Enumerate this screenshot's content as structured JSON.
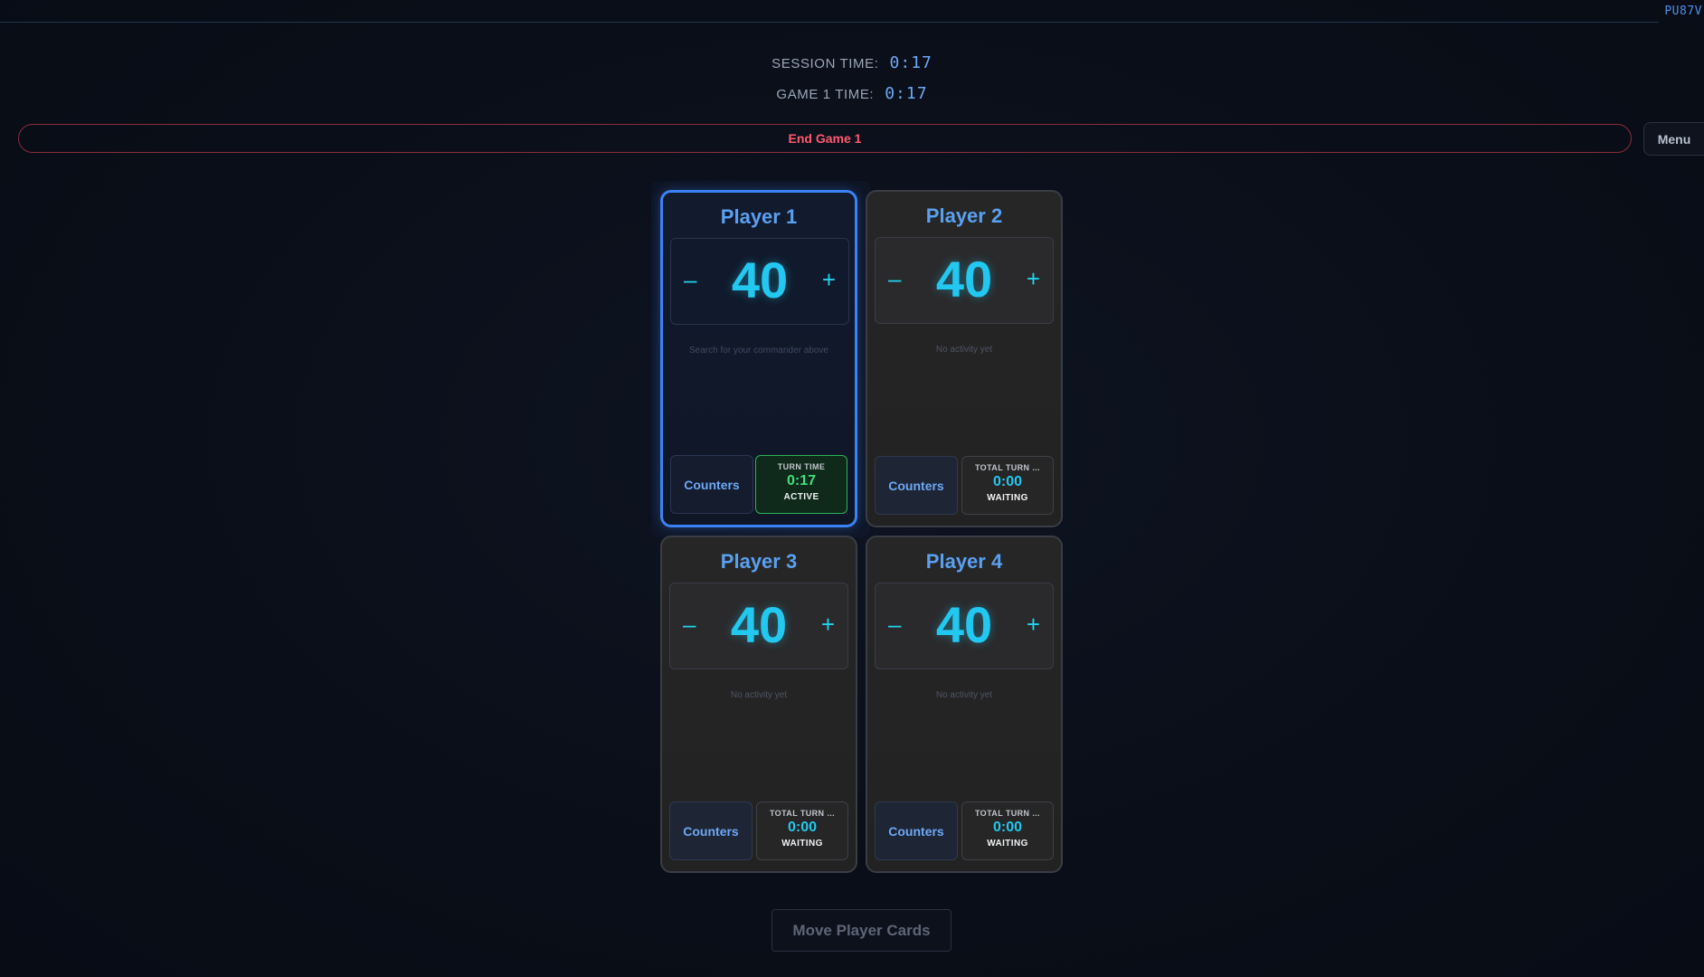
{
  "header": {
    "room_code": "PU87V"
  },
  "timers": {
    "session_label": "SESSION TIME:",
    "session_value": "0:17",
    "game_label": "GAME 1 TIME:",
    "game_value": "0:17"
  },
  "actions": {
    "end_game_label": "End Game 1",
    "menu_label": "Menu",
    "move_cards_label": "Move Player Cards"
  },
  "players": [
    {
      "name": "Player 1",
      "life": "40",
      "minus": "–",
      "plus": "+",
      "activity": "Search for your commander above",
      "counters_label": "Counters",
      "turn_label": "TURN TIME",
      "turn_value": "0:17",
      "turn_status": "ACTIVE",
      "active": true
    },
    {
      "name": "Player 2",
      "life": "40",
      "minus": "–",
      "plus": "+",
      "activity": "No activity yet",
      "counters_label": "Counters",
      "turn_label": "TOTAL TURN ...",
      "turn_value": "0:00",
      "turn_status": "WAITING",
      "active": false
    },
    {
      "name": "Player 3",
      "life": "40",
      "minus": "–",
      "plus": "+",
      "activity": "No activity yet",
      "counters_label": "Counters",
      "turn_label": "TOTAL TURN ...",
      "turn_value": "0:00",
      "turn_status": "WAITING",
      "active": false
    },
    {
      "name": "Player 4",
      "life": "40",
      "minus": "–",
      "plus": "+",
      "activity": "No activity yet",
      "counters_label": "Counters",
      "turn_label": "TOTAL TURN ...",
      "turn_value": "0:00",
      "turn_status": "WAITING",
      "active": false
    }
  ],
  "colors": {
    "accent": "#3b82f6",
    "life": "#22c8f0",
    "active_turn": "#3ee07a",
    "danger": "#ff5a6e"
  }
}
